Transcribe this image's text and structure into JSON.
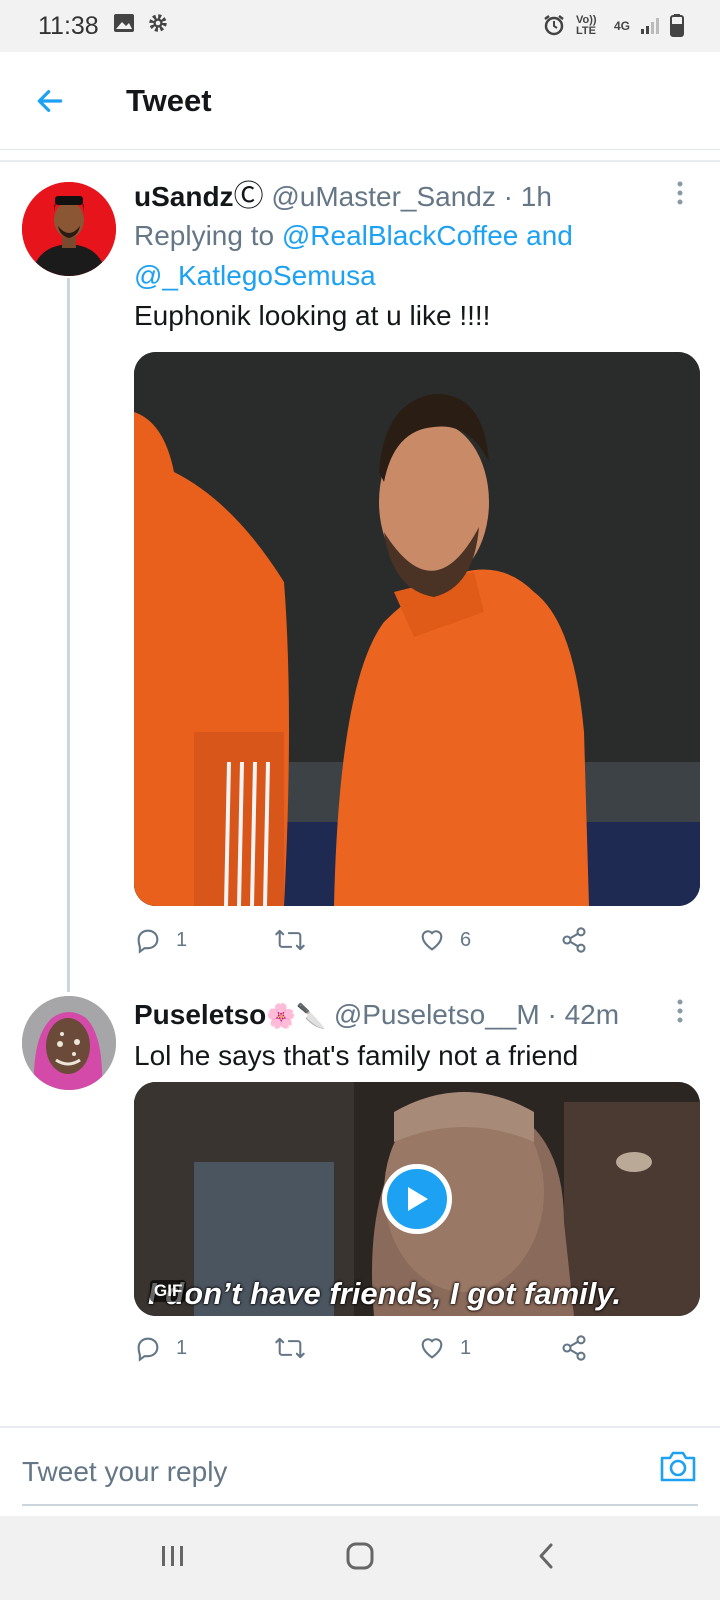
{
  "status_bar": {
    "time": "11:38",
    "network": "Vo)) LTE",
    "signal": "4G"
  },
  "header": {
    "title": "Tweet"
  },
  "tweets": [
    {
      "name": "uSandz",
      "name_badge": "Ⓒ",
      "handle": "@uMaster_Sandz · 1h",
      "reply_prefix": "Replying to ",
      "reply_user1": "@RealBlackCoffee and",
      "reply_user2": "@_KatlegoSemusa",
      "text": "Euphonik looking at u like !!!!",
      "replies": "1",
      "likes": "6"
    },
    {
      "name": "Puseletso",
      "name_emoji": "🌸🔪",
      "handle": "@Puseletso__M · 42m",
      "text": "Lol he says that's family not a friend",
      "gif_caption": "I don’t have friends, I got family.",
      "gif_badge": "GIF",
      "replies": "1",
      "likes": "1"
    }
  ],
  "compose": {
    "placeholder": "Tweet your reply"
  },
  "colors": {
    "accent": "#1da1f2",
    "muted": "#657786"
  }
}
